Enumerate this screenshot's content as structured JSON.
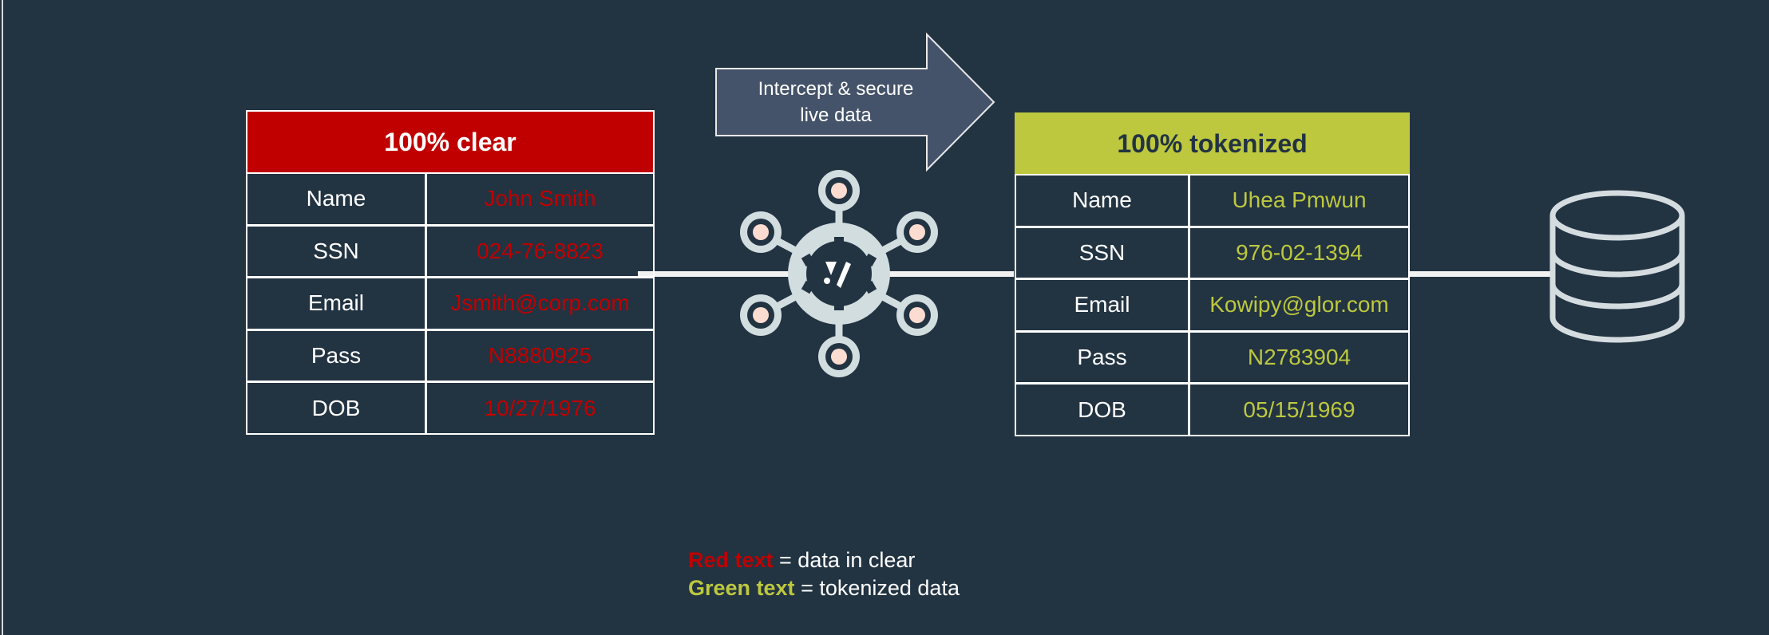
{
  "colors": {
    "background": "#223342",
    "clear_red": "#c00000",
    "token_green": "#bdc83e",
    "arrow_fill": "#45536a",
    "icon_grey": "#d2dde0",
    "node_dot": "#fcdcd0"
  },
  "arrow": {
    "line1": "Intercept & secure",
    "line2": "live data"
  },
  "clear_table": {
    "title": "100% clear",
    "rows": [
      {
        "label": "Name",
        "value": "John Smith"
      },
      {
        "label": "SSN",
        "value": "024-76-8823"
      },
      {
        "label": "Email",
        "value": "Jsmith@corp.com"
      },
      {
        "label": "Pass",
        "value": "N8880925"
      },
      {
        "label": "DOB",
        "value": "10/27/1976"
      }
    ]
  },
  "tokenized_table": {
    "title": "100% tokenized",
    "rows": [
      {
        "label": "Name",
        "value": "Uhea Pmwun"
      },
      {
        "label": "SSN",
        "value": "976-02-1394"
      },
      {
        "label": "Email",
        "value": "Kowipy@glor.com"
      },
      {
        "label": "Pass",
        "value": "N2783904"
      },
      {
        "label": "DOB",
        "value": "05/15/1969"
      }
    ]
  },
  "icons": {
    "hub": "tokenization-hub-icon",
    "database": "database-icon"
  },
  "legend": {
    "red_key": "Red text",
    "red_desc": " = data in clear",
    "green_key": "Green text",
    "green_desc": " = tokenized data"
  }
}
